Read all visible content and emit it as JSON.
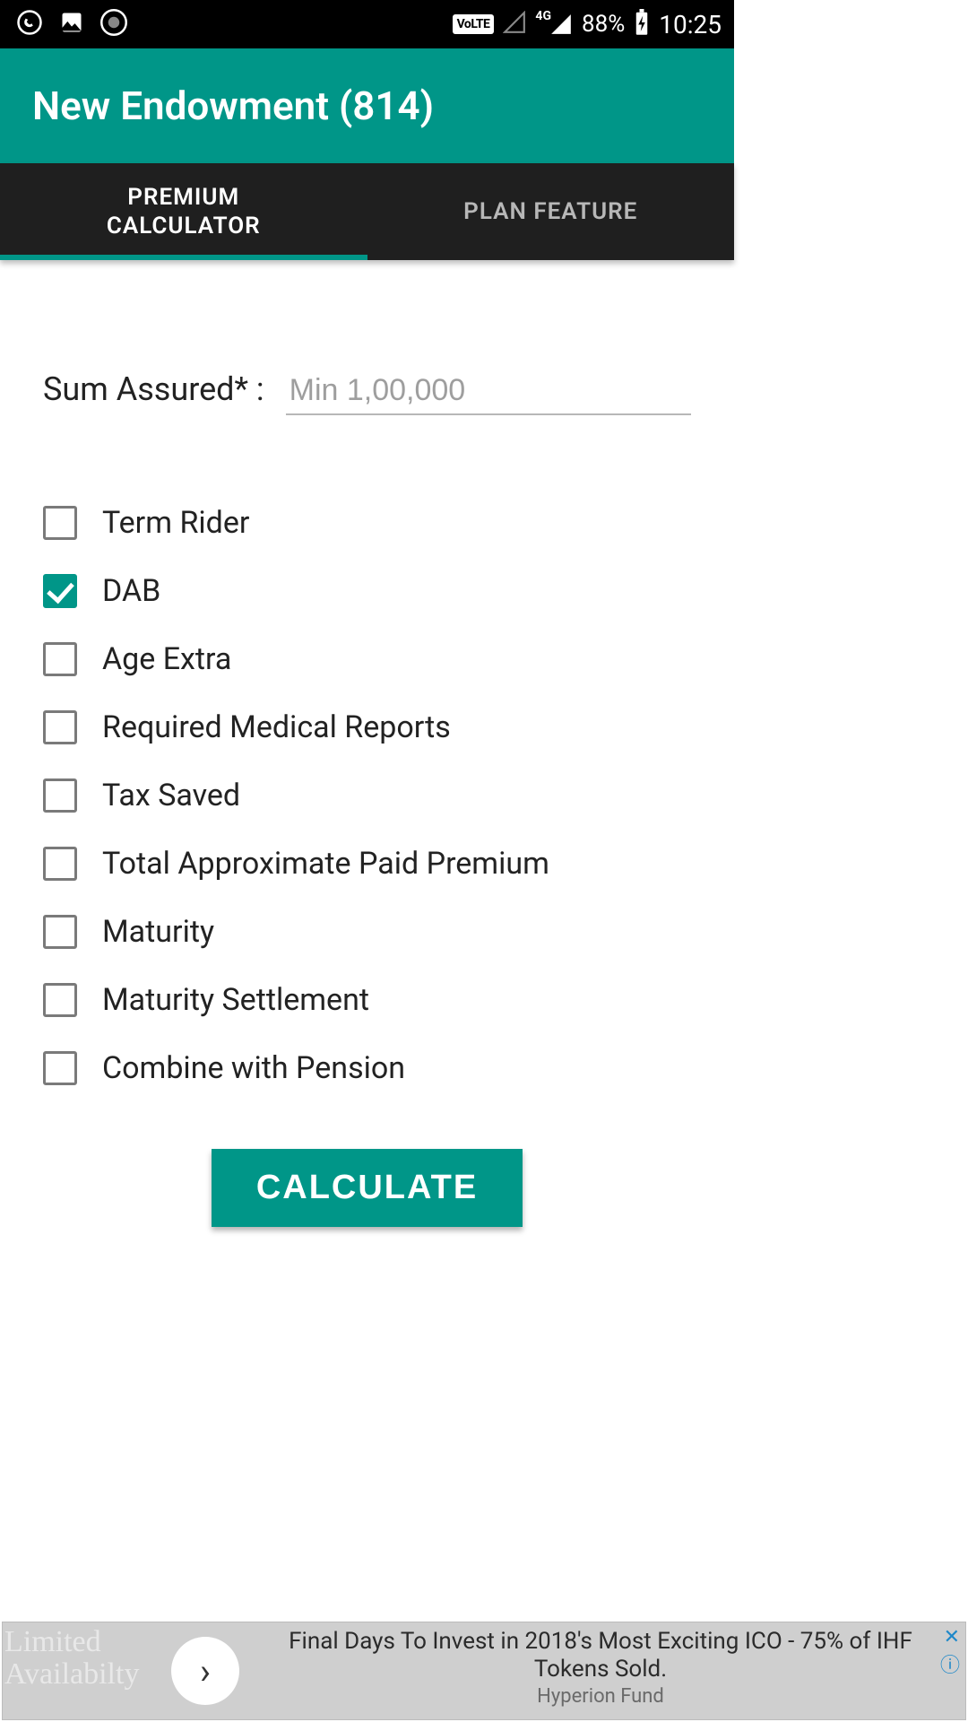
{
  "status": {
    "volte": "VoLTE",
    "network": "4G",
    "battery": "88%",
    "time": "10:25"
  },
  "header": {
    "title": "New Endowment (814)"
  },
  "tabs": [
    {
      "label": "PREMIUM\nCALCULATOR",
      "active": true
    },
    {
      "label": "PLAN FEATURE",
      "active": false
    }
  ],
  "form": {
    "sum_assured_label": "Sum Assured* :",
    "sum_assured_placeholder": "Min 1,00,000",
    "sum_assured_value": ""
  },
  "options": [
    {
      "label": "Term Rider",
      "checked": false
    },
    {
      "label": "DAB",
      "checked": true
    },
    {
      "label": "Age Extra",
      "checked": false
    },
    {
      "label": "Required Medical Reports",
      "checked": false
    },
    {
      "label": "Tax Saved",
      "checked": false
    },
    {
      "label": "Total Approximate Paid Premium",
      "checked": false
    },
    {
      "label": "Maturity",
      "checked": false
    },
    {
      "label": "Maturity Settlement",
      "checked": false
    },
    {
      "label": "Combine with Pension",
      "checked": false
    }
  ],
  "actions": {
    "calculate_label": "CALCULATE"
  },
  "ad": {
    "limited": "Limited\nAvailabilty",
    "headline": "Final Days To Invest in 2018's Most Exciting ICO - 75% of IHF Tokens Sold.",
    "sub": "Hyperion Fund"
  },
  "colors": {
    "accent": "#009688",
    "tab_bg": "#1f1f1f"
  }
}
